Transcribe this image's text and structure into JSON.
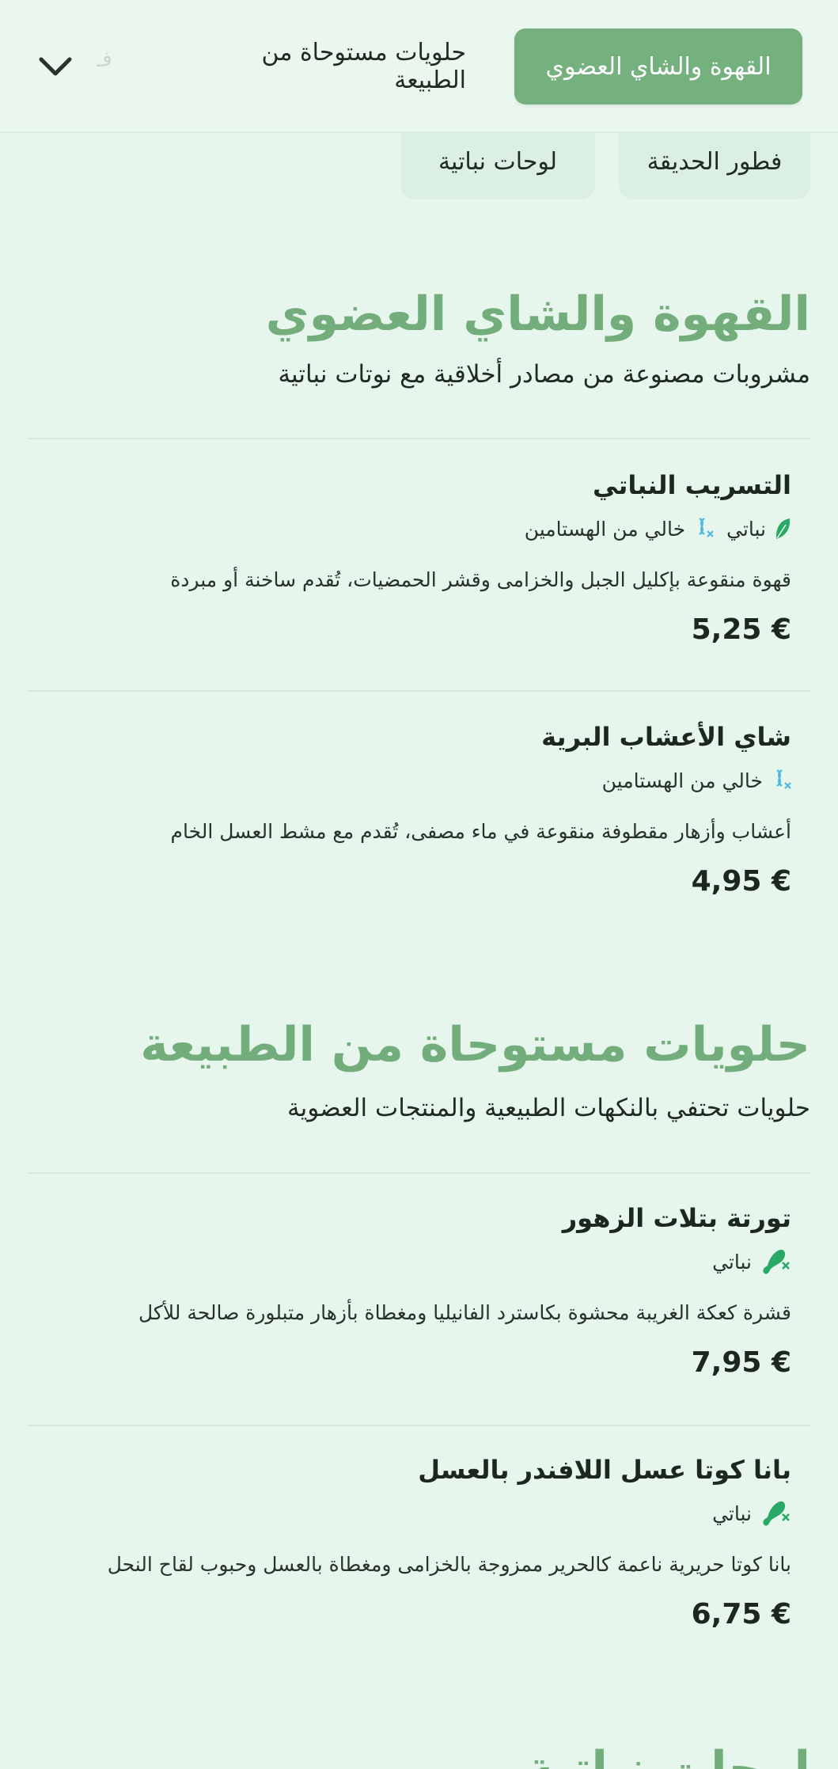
{
  "categories": {
    "active": "القهوة والشاي العضوي",
    "second": "حلويات مستوحاة من الطبيعة",
    "faded": "ف",
    "row2": [
      "فطور الحديقة",
      "لوحات نباتية"
    ]
  },
  "tags": {
    "vegan": "نباتي",
    "histamine_free": "خالي من الهستامين"
  },
  "colors": {
    "accent": "#75b07f",
    "vegan_icon": "#2aa866",
    "histamine_icon": "#4fb9e3",
    "background": "#e6f6ec"
  },
  "sections": [
    {
      "title": "القهوة والشاي العضوي",
      "subtitle": "مشروبات مصنوعة من مصادر أخلاقية مع نوتات نباتية",
      "items": [
        {
          "name": "التسريب النباتي",
          "icons": [
            "leaf-icon",
            "dna-crossed-icon"
          ],
          "desc": "قهوة منقوعة بإكليل الجبل والخزامى وقشر الحمضيات، تُقدم ساخنة أو مبردة",
          "price": "5,25 €"
        },
        {
          "name": "شاي الأعشاب البرية",
          "icons": [
            "dna-crossed-icon"
          ],
          "desc": "أعشاب وأزهار مقطوفة منقوعة في ماء مصفى، تُقدم مع مشط العسل الخام",
          "price": "4,95 €"
        }
      ]
    },
    {
      "title": "حلويات مستوحاة من الطبيعة",
      "subtitle": "حلويات تحتفي بالنكهات الطبيعية والمنتجات العضوية",
      "items": [
        {
          "name": "تورتة بتلات الزهور",
          "icons": [
            "no-meat-icon"
          ],
          "desc": "قشرة كعكة الغريبة محشوة بكاسترد الفانيليا ومغطاة بأزهار متبلورة صالحة للأكل",
          "price": "7,95 €"
        },
        {
          "name": "بانا كوتا عسل اللافندر بالعسل",
          "icons": [
            "no-meat-icon"
          ],
          "desc": "بانا كوتا حريرية ناعمة كالحرير ممزوجة بالخزامى ومغطاة بالعسل وحبوب لقاح النحل",
          "price": "6,75 €"
        }
      ]
    },
    {
      "title": "لوحات نباتية"
    }
  ]
}
